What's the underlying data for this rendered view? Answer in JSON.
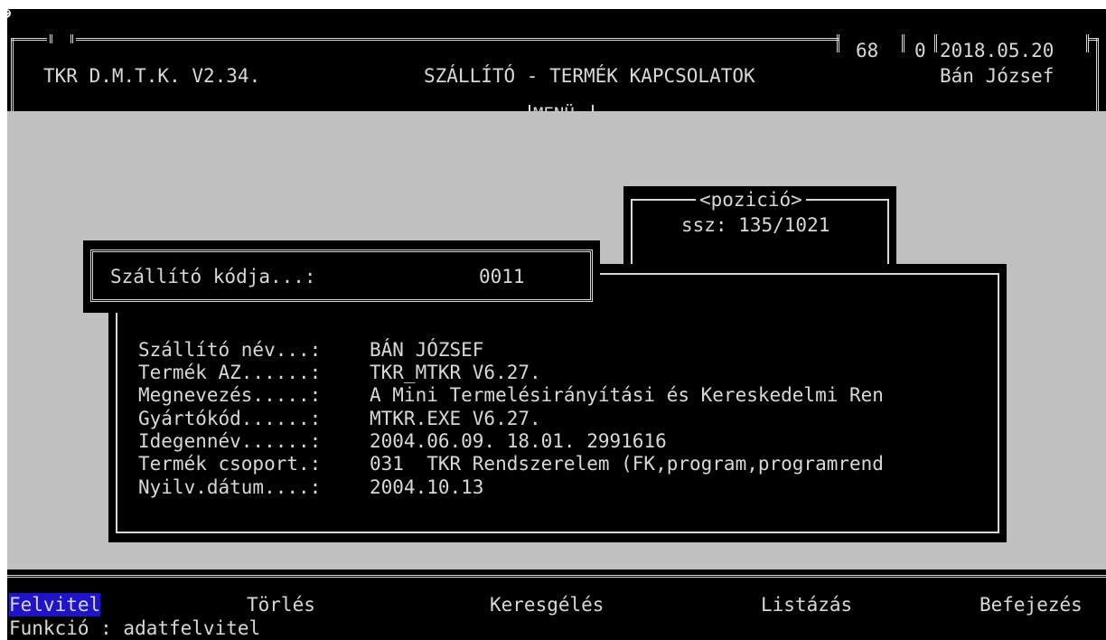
{
  "app_icon": "smiley-icon",
  "header": {
    "title_left": "TKR D.M.T.K. V2.34.",
    "title_center": "SZÁLLÍTÓ - TERMÉK KAPCSOLATOK",
    "counter_a": "68",
    "counter_b": "0",
    "date": "2018.05.20",
    "user": "Bán József",
    "menu_label": "MENÜ"
  },
  "position_box": {
    "title": "<pozició>",
    "value": "ssz: 135/1021"
  },
  "supplier_code": {
    "label": "Szállító kódja...:",
    "value": "0011"
  },
  "details": [
    {
      "label": "Szállító név...:",
      "value": "BÁN JÓZSEF"
    },
    {
      "label": "Termék AZ......:",
      "value": "TKR_MTKR V6.27."
    },
    {
      "label": "Megnevezés.....:",
      "value": "A Mini Termelésirányítási és Kereskedelmi Ren"
    },
    {
      "label": "Gyártókód......:",
      "value": "MTKR.EXE V6.27."
    },
    {
      "label": "Idegennév......:",
      "value": "2004.06.09. 18.01. 2991616"
    },
    {
      "label": "Termék csoport.:",
      "value": "031  TKR Rendszerelem (FK,program,programrend"
    },
    {
      "label": "Nyilv.dátum....:",
      "value": "2004.10.13"
    }
  ],
  "menu_bar": {
    "items": [
      {
        "label": "Felvitel",
        "selected": true
      },
      {
        "label": "Törlés",
        "selected": false
      },
      {
        "label": "Keresgélés",
        "selected": false
      },
      {
        "label": "Listázás",
        "selected": false
      },
      {
        "label": "Befejezés",
        "selected": false
      }
    ],
    "status": "Funkció : adatfelvitel"
  },
  "colors": {
    "background": "#000000",
    "foreground": "#d8d8d8",
    "panel_gray": "#c0c0c0",
    "highlight_bg": "#1f14c8",
    "highlight_fg": "#d8d8d8"
  }
}
